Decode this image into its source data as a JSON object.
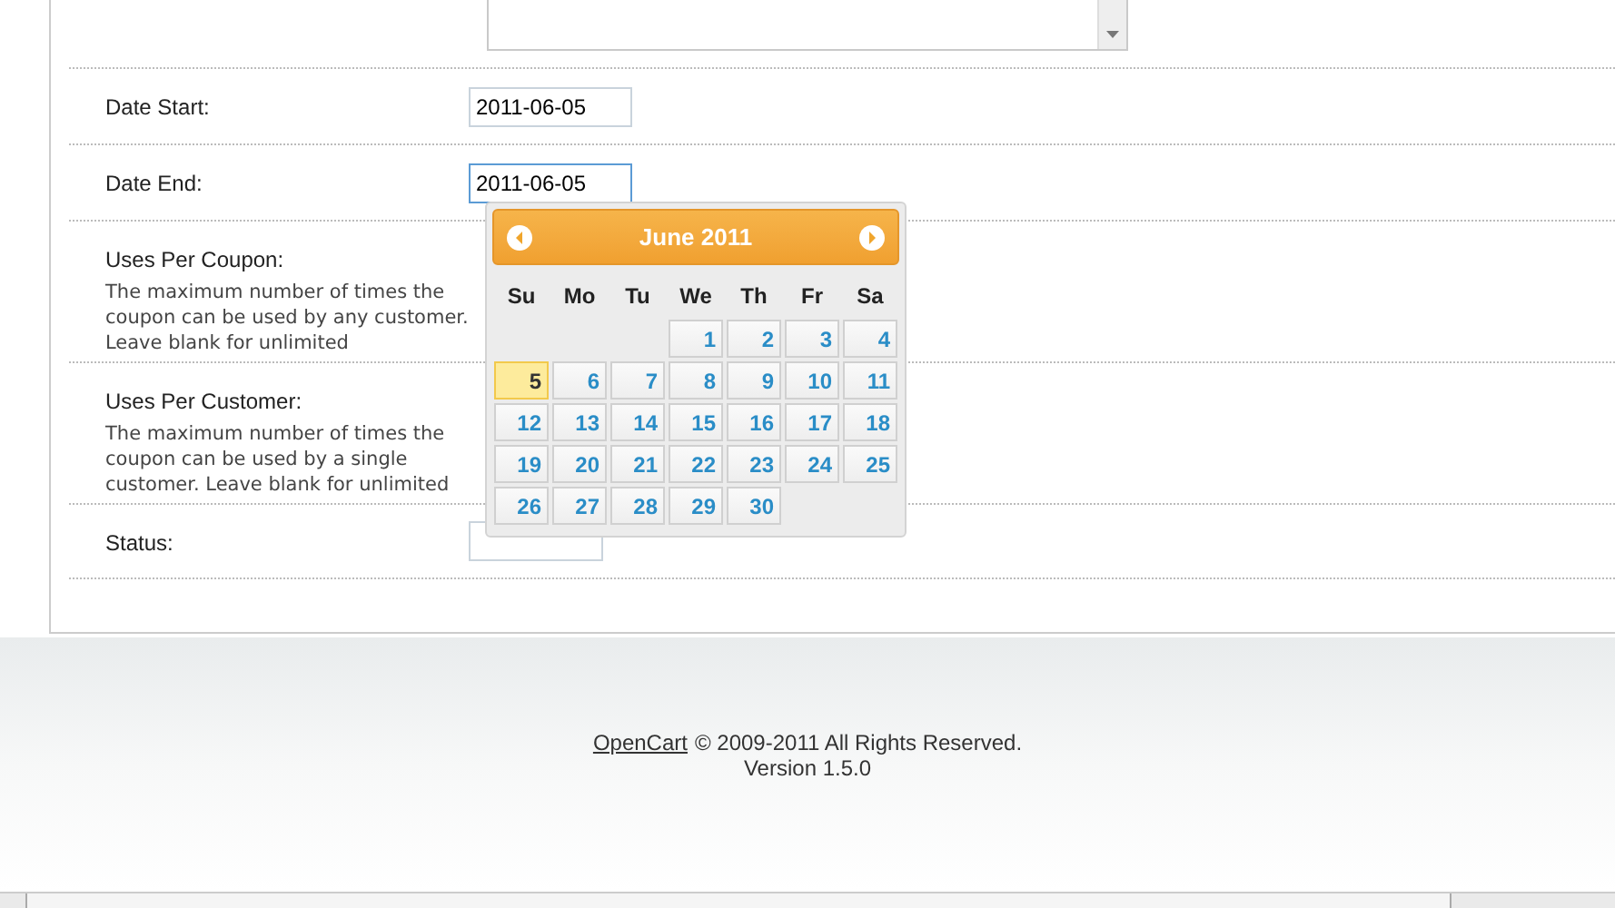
{
  "form": {
    "rows": [
      {
        "kind": "date",
        "label": "Date Start:",
        "value": "2011-06-05",
        "focused": false
      },
      {
        "kind": "date",
        "label": "Date End:",
        "value": "2011-06-05",
        "focused": true
      },
      {
        "kind": "note",
        "label": "Uses Per Coupon:",
        "help": "The maximum number of times the coupon can be used by any customer. Leave blank for unlimited"
      },
      {
        "kind": "note",
        "label": "Uses Per Customer:",
        "help": "The maximum number of times the coupon can be used by a single customer. Leave blank for unlimited"
      },
      {
        "kind": "select",
        "label": "Status:"
      }
    ]
  },
  "datepicker": {
    "title": "June 2011",
    "weekdays": [
      "Su",
      "Mo",
      "Tu",
      "We",
      "Th",
      "Fr",
      "Sa"
    ],
    "weeks": [
      [
        {
          "day": "1",
          "selected": false
        },
        {
          "day": "2",
          "selected": false
        },
        {
          "day": "3",
          "selected": false
        },
        {
          "day": "4",
          "selected": false
        }
      ],
      [
        {
          "day": "5",
          "selected": true
        },
        {
          "day": "6",
          "selected": false
        },
        {
          "day": "7",
          "selected": false
        },
        {
          "day": "8",
          "selected": false
        },
        {
          "day": "9",
          "selected": false
        },
        {
          "day": "10",
          "selected": false
        },
        {
          "day": "11",
          "selected": false
        }
      ],
      [
        {
          "day": "12",
          "selected": false
        },
        {
          "day": "13",
          "selected": false
        },
        {
          "day": "14",
          "selected": false
        },
        {
          "day": "15",
          "selected": false
        },
        {
          "day": "16",
          "selected": false
        },
        {
          "day": "17",
          "selected": false
        },
        {
          "day": "18",
          "selected": false
        }
      ],
      [
        {
          "day": "19",
          "selected": false
        },
        {
          "day": "20",
          "selected": false
        },
        {
          "day": "21",
          "selected": false
        },
        {
          "day": "22",
          "selected": false
        },
        {
          "day": "23",
          "selected": false
        },
        {
          "day": "24",
          "selected": false
        },
        {
          "day": "25",
          "selected": false
        }
      ],
      [
        {
          "day": "26",
          "selected": false
        },
        {
          "day": "27",
          "selected": false
        },
        {
          "day": "28",
          "selected": false
        },
        {
          "day": "29",
          "selected": false
        },
        {
          "day": "30",
          "selected": false
        }
      ]
    ]
  },
  "footer": {
    "link": "OpenCart",
    "copyright": "© 2009-2011 All Rights Reserved.",
    "version": "Version 1.5.0"
  }
}
